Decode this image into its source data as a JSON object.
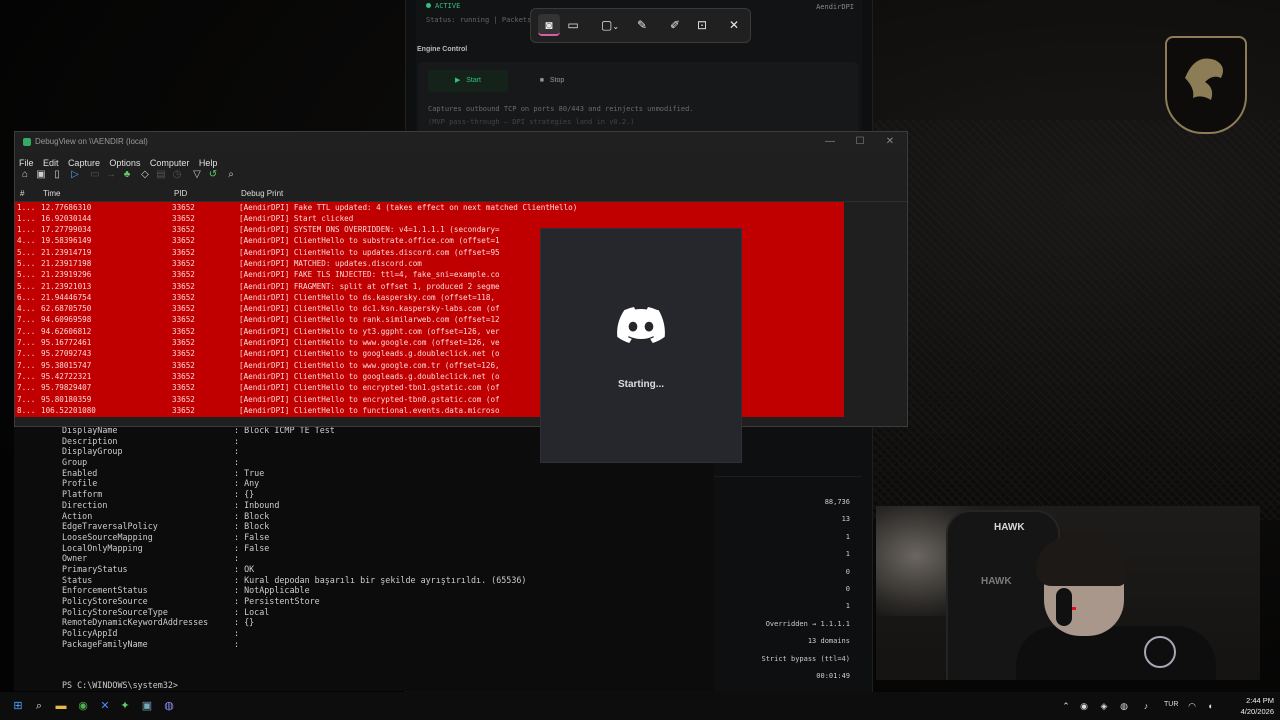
{
  "dpi": {
    "status": "ACTIVE",
    "status_sub": "Status: running  |  Packets:",
    "brand": "AendirDPI",
    "section": "Engine Control",
    "start_label": "Start",
    "stop_label": "Stop",
    "desc1": "Captures outbound TCP on ports 80/443 and reinjects unmodified.",
    "desc2": "(MVP pass-through — DPI strategies land in v0.2.)",
    "stats": [
      "88,736",
      "13",
      "1",
      "1",
      "0",
      "0",
      "1",
      "Overridden → 1.1.1.1",
      "13 domains",
      "Strict bypass (ttl=4)",
      "00:01:49"
    ]
  },
  "debugview": {
    "title": "DebugView on \\\\AENDIR (local)",
    "menu": [
      "File",
      "Edit",
      "Capture",
      "Options",
      "Computer",
      "Help"
    ],
    "columns": {
      "num": "#",
      "time": "Time",
      "pid": "PID",
      "msg": "Debug Print"
    },
    "rows": [
      {
        "num": "1...",
        "time": "12.77686310",
        "pid": "33652",
        "msg": "[AendirDPI] Fake TTL updated: 4 (takes effect on next matched ClientHello)"
      },
      {
        "num": "1...",
        "time": "16.92030144",
        "pid": "33652",
        "msg": "[AendirDPI] Start clicked"
      },
      {
        "num": "1...",
        "time": "17.27799034",
        "pid": "33652",
        "msg": "[AendirDPI] SYSTEM DNS OVERRIDDEN: v4=1.1.1.1 (secondary="
      },
      {
        "num": "4...",
        "time": "19.58396149",
        "pid": "33652",
        "msg": "[AendirDPI] ClientHello to substrate.office.com (offset=1"
      },
      {
        "num": "5...",
        "time": "21.23914719",
        "pid": "33652",
        "msg": "[AendirDPI] ClientHello to updates.discord.com (offset=95"
      },
      {
        "num": "5...",
        "time": "21.23917198",
        "pid": "33652",
        "msg": "[AendirDPI] MATCHED: updates.discord.com"
      },
      {
        "num": "5...",
        "time": "21.23919296",
        "pid": "33652",
        "msg": "[AendirDPI] FAKE TLS INJECTED: ttl=4, fake_sni=example.co"
      },
      {
        "num": "5...",
        "time": "21.23921013",
        "pid": "33652",
        "msg": "[AendirDPI] FRAGMENT: split at offset 1, produced 2 segme"
      },
      {
        "num": "6...",
        "time": "21.94446754",
        "pid": "33652",
        "msg": "[AendirDPI] ClientHello to ds.kaspersky.com (offset=118,"
      },
      {
        "num": "4...",
        "time": "62.68705750",
        "pid": "33652",
        "msg": "[AendirDPI] ClientHello to dc1.ksn.kaspersky-labs.com (of"
      },
      {
        "num": "7...",
        "time": "94.60969598",
        "pid": "33652",
        "msg": "[AendirDPI] ClientHello to rank.similarweb.com (offset=12"
      },
      {
        "num": "7...",
        "time": "94.62606812",
        "pid": "33652",
        "msg": "[AendirDPI] ClientHello to yt3.ggpht.com (offset=126, ver"
      },
      {
        "num": "7...",
        "time": "95.16772461",
        "pid": "33652",
        "msg": "[AendirDPI] ClientHello to www.google.com (offset=126, ve"
      },
      {
        "num": "7...",
        "time": "95.27092743",
        "pid": "33652",
        "msg": "[AendirDPI] ClientHello to googleads.g.doubleclick.net (o"
      },
      {
        "num": "7...",
        "time": "95.38015747",
        "pid": "33652",
        "msg": "[AendirDPI] ClientHello to www.google.com.tr (offset=126,"
      },
      {
        "num": "7...",
        "time": "95.42722321",
        "pid": "33652",
        "msg": "[AendirDPI] ClientHello to googleads.g.doubleclick.net (o"
      },
      {
        "num": "7...",
        "time": "95.79829407",
        "pid": "33652",
        "msg": "[AendirDPI] ClientHello to encrypted-tbn1.gstatic.com (of"
      },
      {
        "num": "7...",
        "time": "95.80180359",
        "pid": "33652",
        "msg": "[AendirDPI] ClientHello to encrypted-tbn0.gstatic.com (of"
      },
      {
        "num": "8...",
        "time": "106.52201080",
        "pid": "33652",
        "msg": "[AendirDPI] ClientHello to functional.events.data.microso"
      }
    ]
  },
  "powershell": {
    "rows": [
      {
        "key": "DisplayName",
        "val": "Block ICMP TE Test"
      },
      {
        "key": "Description",
        "val": ""
      },
      {
        "key": "DisplayGroup",
        "val": ""
      },
      {
        "key": "Group",
        "val": ""
      },
      {
        "key": "Enabled",
        "val": "True"
      },
      {
        "key": "Profile",
        "val": "Any"
      },
      {
        "key": "Platform",
        "val": "{}"
      },
      {
        "key": "Direction",
        "val": "Inbound"
      },
      {
        "key": "Action",
        "val": "Block"
      },
      {
        "key": "EdgeTraversalPolicy",
        "val": "Block"
      },
      {
        "key": "LooseSourceMapping",
        "val": "False"
      },
      {
        "key": "LocalOnlyMapping",
        "val": "False"
      },
      {
        "key": "Owner",
        "val": ""
      },
      {
        "key": "PrimaryStatus",
        "val": "OK"
      },
      {
        "key": "Status",
        "val": "Kural depodan başarılı bir şekilde ayrıştırıldı. (65536)"
      },
      {
        "key": "EnforcementStatus",
        "val": "NotApplicable"
      },
      {
        "key": "PolicyStoreSource",
        "val": "PersistentStore"
      },
      {
        "key": "PolicyStoreSourceType",
        "val": "Local"
      },
      {
        "key": "RemoteDynamicKeywordAddresses",
        "val": "{}"
      },
      {
        "key": "PolicyAppId",
        "val": ""
      },
      {
        "key": "PackageFamilyName",
        "val": ""
      }
    ],
    "prompt": "PS C:\\WINDOWS\\system32>"
  },
  "discord": {
    "status": "Starting..."
  },
  "webcam": {
    "chair_brand": "HAWK"
  },
  "taskbar": {
    "lang": "TUR",
    "time": "2:44 PM",
    "date": "4/20/2026"
  },
  "colors": {
    "debug_highlight": "#c00000",
    "active_green": "#2ec27e",
    "discord_bg": "#26272d"
  }
}
